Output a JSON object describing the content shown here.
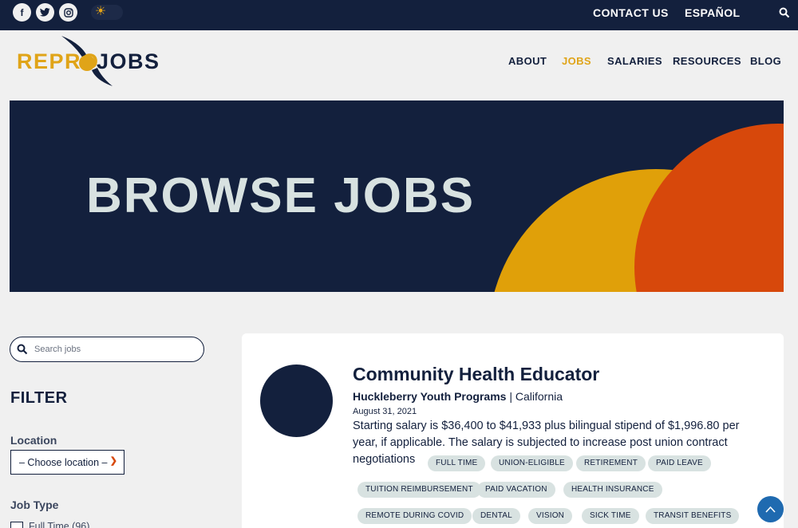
{
  "topbar": {
    "social": [
      {
        "name": "facebook-icon",
        "glyph": "f"
      },
      {
        "name": "twitter-icon",
        "glyph": "t"
      },
      {
        "name": "instagram-icon",
        "glyph": "◎"
      }
    ],
    "theme_toggle_icon": "sun-icon",
    "links": [
      "CONTACT US",
      "ESPAÑOL"
    ],
    "search_icon": "search-icon"
  },
  "header": {
    "logo": {
      "part1": "REPRO",
      "part2": "JOBS"
    },
    "nav": [
      {
        "label": "ABOUT",
        "active": false
      },
      {
        "label": "JOBS",
        "active": true
      },
      {
        "label": "SALARIES",
        "active": false
      },
      {
        "label": "RESOURCES",
        "active": false
      },
      {
        "label": "BLOG",
        "active": false
      }
    ]
  },
  "hero": {
    "title": "BROWSE JOBS"
  },
  "sidebar": {
    "search_placeholder": "Search jobs",
    "filter_title": "FILTER",
    "location_label": "Location",
    "location_value": "– Choose location –",
    "job_type_label": "Job Type",
    "job_type_options": [
      {
        "label": "Full Time (96)",
        "checked": false
      }
    ]
  },
  "job": {
    "title": "Community Health Educator",
    "company": "Huckleberry Youth Programs",
    "location": "California",
    "date": "August 31, 2021",
    "description": "Starting salary is $36,400 to $41,933 plus bilingual stipend of $1,996.80 per year, if applicable. The salary is subjected to increase post union contract negotiations",
    "tags": [
      "FULL TIME",
      "UNION-ELIGIBLE",
      "RETIREMENT",
      "PAID LEAVE",
      "TUITION REIMBURSEMENT",
      "PAID VACATION",
      "HEALTH INSURANCE",
      "REMOTE DURING COVID",
      "DENTAL",
      "VISION",
      "SICK TIME",
      "TRANSIT BENEFITS"
    ]
  },
  "colors": {
    "navy": "#13203d",
    "gold": "#e0a418",
    "orange": "#d7480b",
    "tag_bg": "#d8e2e1",
    "scroll_blue": "#1f6ab0"
  }
}
